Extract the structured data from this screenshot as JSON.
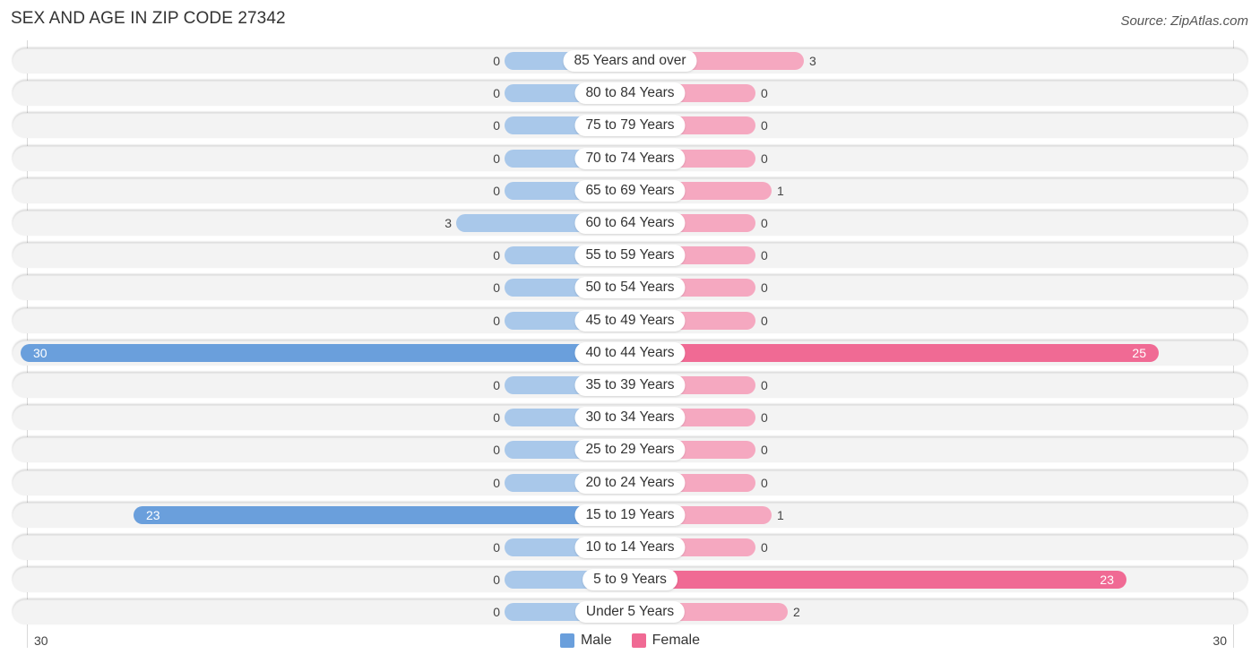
{
  "header": {
    "title": "SEX AND AGE IN ZIP CODE 27342",
    "source": "Source: ZipAtlas.com"
  },
  "colors": {
    "male": "#6a9fdc",
    "male_light": "#a9c8ea",
    "female": "#f06a94",
    "female_light": "#f5a8c0"
  },
  "chart_data": {
    "type": "bar",
    "orientation": "horizontal-diverging",
    "title": "SEX AND AGE IN ZIP CODE 27342",
    "categories": [
      "85 Years and over",
      "80 to 84 Years",
      "75 to 79 Years",
      "70 to 74 Years",
      "65 to 69 Years",
      "60 to 64 Years",
      "55 to 59 Years",
      "50 to 54 Years",
      "45 to 49 Years",
      "40 to 44 Years",
      "35 to 39 Years",
      "30 to 34 Years",
      "25 to 29 Years",
      "20 to 24 Years",
      "15 to 19 Years",
      "10 to 14 Years",
      "5 to 9 Years",
      "Under 5 Years"
    ],
    "series": [
      {
        "name": "Male",
        "values": [
          0,
          0,
          0,
          0,
          0,
          3,
          0,
          0,
          0,
          30,
          0,
          0,
          0,
          0,
          23,
          0,
          0,
          0
        ]
      },
      {
        "name": "Female",
        "values": [
          3,
          0,
          0,
          0,
          1,
          0,
          0,
          0,
          0,
          25,
          0,
          0,
          0,
          0,
          1,
          0,
          23,
          2
        ]
      }
    ],
    "axis": {
      "left_label": "30",
      "right_label": "30",
      "max": 30
    },
    "legend": {
      "position": "bottom-center",
      "entries": [
        "Male",
        "Female"
      ]
    },
    "xlabel": "",
    "ylabel": ""
  }
}
